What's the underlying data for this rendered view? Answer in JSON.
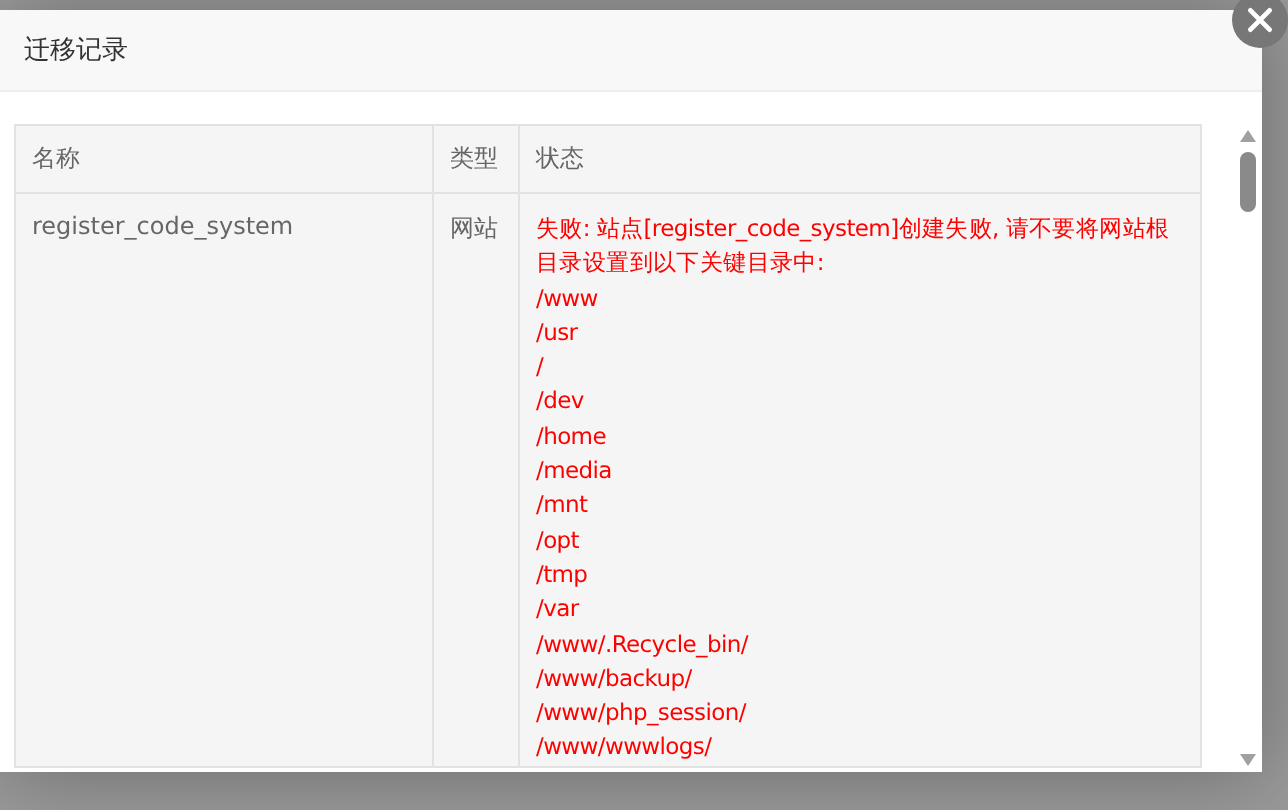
{
  "dialog": {
    "title": "迁移记录"
  },
  "table": {
    "columns": [
      "名称",
      "类型",
      "状态"
    ],
    "rows": [
      {
        "name": "register_code_system",
        "type": "网站",
        "status": {
          "message": "失败: 站点[register_code_system]创建失败, 请不要将网站根目录设置到以下关键目录中:",
          "paths": [
            "/www",
            "/usr",
            "/",
            "/dev",
            "/home",
            "/media",
            "/mnt",
            "/opt",
            "/tmp",
            "/var",
            "/www/.Recycle_bin/",
            "/www/backup/",
            "/www/php_session/",
            "/www/wwwlogs/"
          ]
        }
      }
    ]
  }
}
